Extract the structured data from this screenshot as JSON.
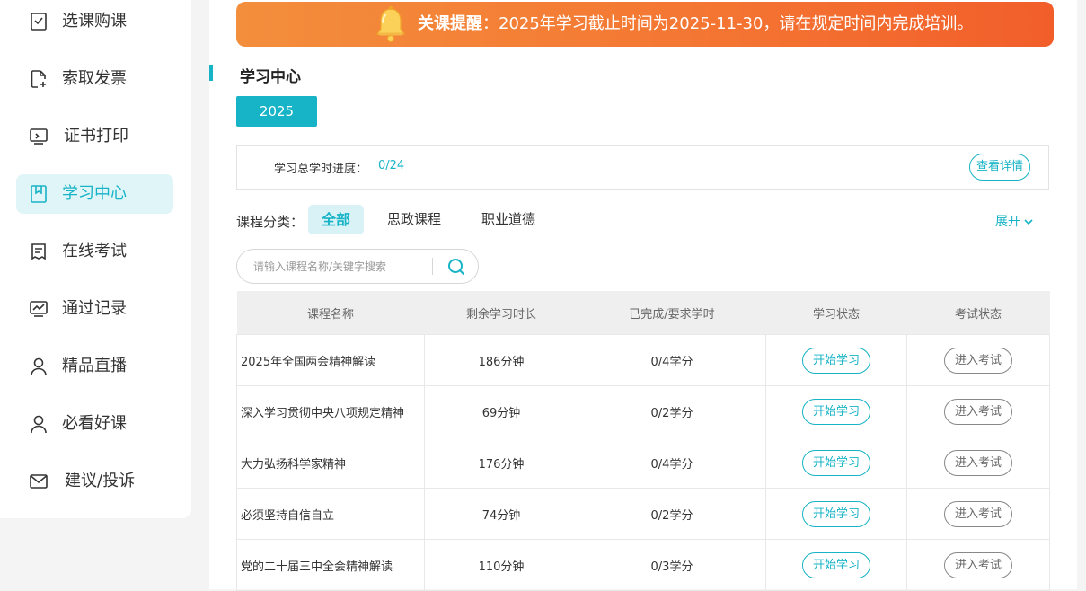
{
  "colors": {
    "accent": "#17b3c6",
    "banner_start": "#f38e3c",
    "banner_end": "#f25e2a"
  },
  "sidebar": {
    "items": [
      {
        "label": "选课购课",
        "icon": "checklist-icon",
        "active": false
      },
      {
        "label": "索取发票",
        "icon": "invoice-add-icon",
        "active": false
      },
      {
        "label": "证书打印",
        "icon": "monitor-print-icon",
        "active": false
      },
      {
        "label": "学习中心",
        "icon": "bookmark-book-icon",
        "active": true
      },
      {
        "label": "在线考试",
        "icon": "exam-paper-icon",
        "active": false
      },
      {
        "label": "通过记录",
        "icon": "chart-record-icon",
        "active": false
      },
      {
        "label": "精品直播",
        "icon": "user-icon",
        "active": false
      },
      {
        "label": "必看好课",
        "icon": "user-icon",
        "active": false
      },
      {
        "label": "建议/投诉",
        "icon": "mail-icon",
        "active": false
      }
    ]
  },
  "banner": {
    "strong": "关课提醒",
    "text": "：2025年学习截止时间为2025-11-30，请在规定时间内完成培训。"
  },
  "section": {
    "title": "学习中心"
  },
  "year_tab": "2025",
  "progress": {
    "label": "学习总学时进度：",
    "value": "0/24",
    "detail_button": "查看详情"
  },
  "category": {
    "label": "课程分类：",
    "tabs": [
      "全部",
      "思政课程",
      "职业道德"
    ],
    "expand": "展开"
  },
  "search": {
    "placeholder": "请输入课程名称/关键字搜索"
  },
  "table": {
    "headers": [
      "课程名称",
      "剩余学习时长",
      "已完成/要求学时",
      "学习状态",
      "考试状态"
    ],
    "rows": [
      {
        "name": "2025年全国两会精神解读",
        "remaining": "186分钟",
        "credits": "0/4学分",
        "study": "开始学习",
        "exam": "进入考试"
      },
      {
        "name": "深入学习贯彻中央八项规定精神",
        "remaining": "69分钟",
        "credits": "0/2学分",
        "study": "开始学习",
        "exam": "进入考试"
      },
      {
        "name": "大力弘扬科学家精神",
        "remaining": "176分钟",
        "credits": "0/4学分",
        "study": "开始学习",
        "exam": "进入考试"
      },
      {
        "name": "必须坚持自信自立",
        "remaining": "74分钟",
        "credits": "0/2学分",
        "study": "开始学习",
        "exam": "进入考试"
      },
      {
        "name": "党的二十届三中全会精神解读",
        "remaining": "110分钟",
        "credits": "0/3学分",
        "study": "开始学习",
        "exam": "进入考试"
      }
    ]
  }
}
